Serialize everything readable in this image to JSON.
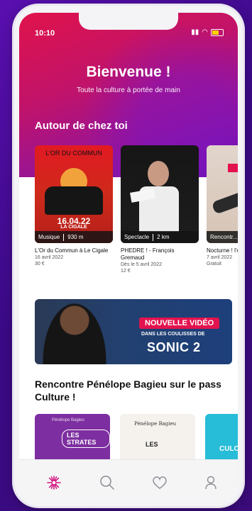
{
  "status_bar": {
    "time": "10:10",
    "icons": [
      "signal-icon",
      "wifi-icon",
      "battery-icon"
    ]
  },
  "header": {
    "title": "Bienvenue !",
    "tagline": "Toute la culture à portée de main"
  },
  "nearby": {
    "title": "Autour de chez toi",
    "cards": [
      {
        "category": "Musique",
        "distance": "930 m",
        "title": "L'Or du Commun à Le Cigale",
        "date": "16 avril 2022",
        "price": "30 €",
        "poster_title": "L'OR DU COMMUN",
        "poster_date": "16.04.22",
        "poster_venue": "LA CIGALE"
      },
      {
        "category": "Spectacle",
        "distance": "2 km",
        "title": "PHEDRE ! - François Gremaud",
        "date": "Dès le 5 avril 2022",
        "price": "12 €"
      },
      {
        "category": "Rencontr...",
        "distance": "",
        "title": "Nocturne ! l'ère des ré",
        "date": "7 avril 2022",
        "price": "Gratuit"
      }
    ]
  },
  "banner": {
    "badge": "NOUVELLE VIDÉO",
    "subtitle": "DANS LES COULISSES DE",
    "title": "SONIC 2"
  },
  "rencontre": {
    "title": "Rencontre Pénélope Bagieu sur le pass Culture !",
    "thumbs": [
      {
        "small": "Pénélope Bagieu",
        "label": "LES STRATES"
      },
      {
        "small": "Pénélope Bagieu",
        "label": "LES"
      },
      {
        "label": "CULO"
      }
    ]
  },
  "tabbar": {
    "items": [
      "home-icon",
      "search-icon",
      "favorites-icon",
      "profile-icon"
    ],
    "active_color": "#d21a84",
    "inactive_color": "#8a8a92"
  },
  "colors": {
    "brand_pink": "#e2134f",
    "brand_purple": "#6b12b6"
  }
}
